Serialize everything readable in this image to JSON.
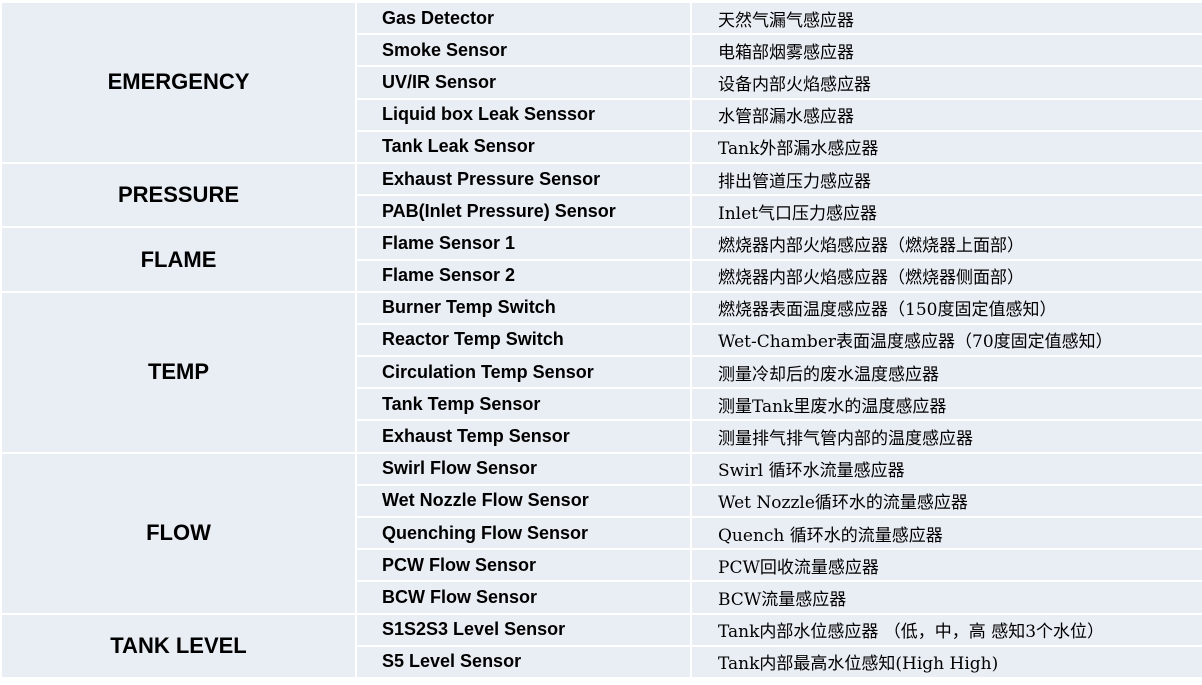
{
  "groups": [
    {
      "category": "EMERGENCY",
      "rows": [
        {
          "name": "Gas Detector",
          "desc": "天然气漏气感应器"
        },
        {
          "name": "Smoke Sensor",
          "desc": "电箱部烟雾感应器"
        },
        {
          "name": "UV/IR Sensor",
          "desc": "设备内部火焰感应器"
        },
        {
          "name": "Liquid box Leak Senssor",
          "desc": "水管部漏水感应器"
        },
        {
          "name": "Tank Leak Sensor",
          "desc": "Tank外部漏水感应器"
        }
      ]
    },
    {
      "category": "PRESSURE",
      "rows": [
        {
          "name": "Exhaust Pressure Sensor",
          "desc": "排出管道压力感应器"
        },
        {
          "name": "PAB(Inlet Pressure) Sensor",
          "desc": "Inlet气口压力感应器"
        }
      ]
    },
    {
      "category": "FLAME",
      "rows": [
        {
          "name": "Flame Sensor 1",
          "desc": "燃烧器内部火焰感应器（燃烧器上面部）"
        },
        {
          "name": "Flame Sensor 2",
          "desc": "燃烧器内部火焰感应器（燃烧器侧面部）"
        }
      ]
    },
    {
      "category": "TEMP",
      "rows": [
        {
          "name": "Burner Temp Switch",
          "desc": "燃烧器表面温度感应器（150度固定值感知）"
        },
        {
          "name": "Reactor Temp Switch",
          "desc": "Wet-Chamber表面温度感应器（70度固定值感知）"
        },
        {
          "name": "Circulation Temp Sensor",
          "desc": "测量冷却后的废水温度感应器"
        },
        {
          "name": "Tank Temp Sensor",
          "desc": "测量Tank里废水的温度感应器"
        },
        {
          "name": "Exhaust Temp Sensor",
          "desc": "测量排气排气管内部的温度感应器"
        }
      ]
    },
    {
      "category": "FLOW",
      "rows": [
        {
          "name": "Swirl Flow Sensor",
          "desc": "Swirl 循环水流量感应器"
        },
        {
          "name": "Wet Nozzle Flow Sensor",
          "desc": "Wet Nozzle循环水的流量感应器"
        },
        {
          "name": "Quenching Flow Sensor",
          "desc": "Quench 循环水的流量感应器"
        },
        {
          "name": "PCW Flow Sensor",
          "desc": "PCW回收流量感应器"
        },
        {
          "name": "BCW Flow Sensor",
          "desc": "BCW流量感应器"
        }
      ]
    },
    {
      "category": "TANK LEVEL",
      "rows": [
        {
          "name": "S1S2S3 Level Sensor",
          "desc": "Tank内部水位感应器 （低，中，高 感知3个水位）"
        },
        {
          "name": "S5 Level Sensor",
          "desc": "Tank内部最高水位感知(High High)"
        }
      ]
    }
  ],
  "colors": {
    "cell_background": "#e9edf4",
    "grid_line": "#ffffff",
    "text": "#000000"
  }
}
